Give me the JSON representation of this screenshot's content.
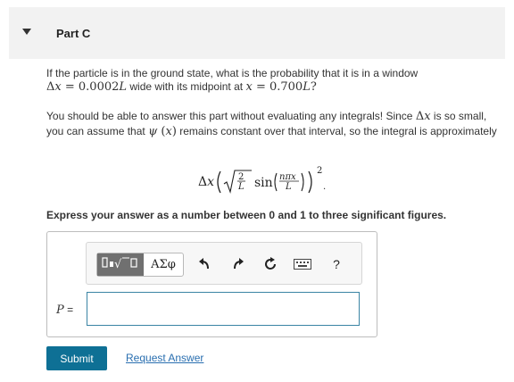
{
  "part": {
    "title": "Part C"
  },
  "question": {
    "text1": "If the particle is in the ground state, what is the probability that it is in a window",
    "dx_value": "0.0002",
    "text2": "wide with its midpoint at",
    "x_value": "0.700",
    "hint1": "You should be able to answer this part without evaluating any integrals! Since",
    "hint2": "is so small, you can assume that",
    "hint3": "remains constant over that interval, so the integral is approximately"
  },
  "instruction": "Express your answer as a number between 0 and 1 to three significant figures.",
  "toolbar": {
    "greek_label": "ΑΣφ",
    "help_label": "?",
    "icons": [
      "templates-icon",
      "undo-icon",
      "redo-icon",
      "reset-icon",
      "keyboard-icon",
      "help-icon"
    ]
  },
  "answer": {
    "variable": "P",
    "equals": "=",
    "value": ""
  },
  "buttons": {
    "submit_label": "Submit",
    "request_label": "Request Answer"
  },
  "colors": {
    "submit_bg": "#0e7095",
    "link": "#2a6fb0",
    "input_border": "#3a84a4",
    "header_bg": "#f2f2f2"
  }
}
